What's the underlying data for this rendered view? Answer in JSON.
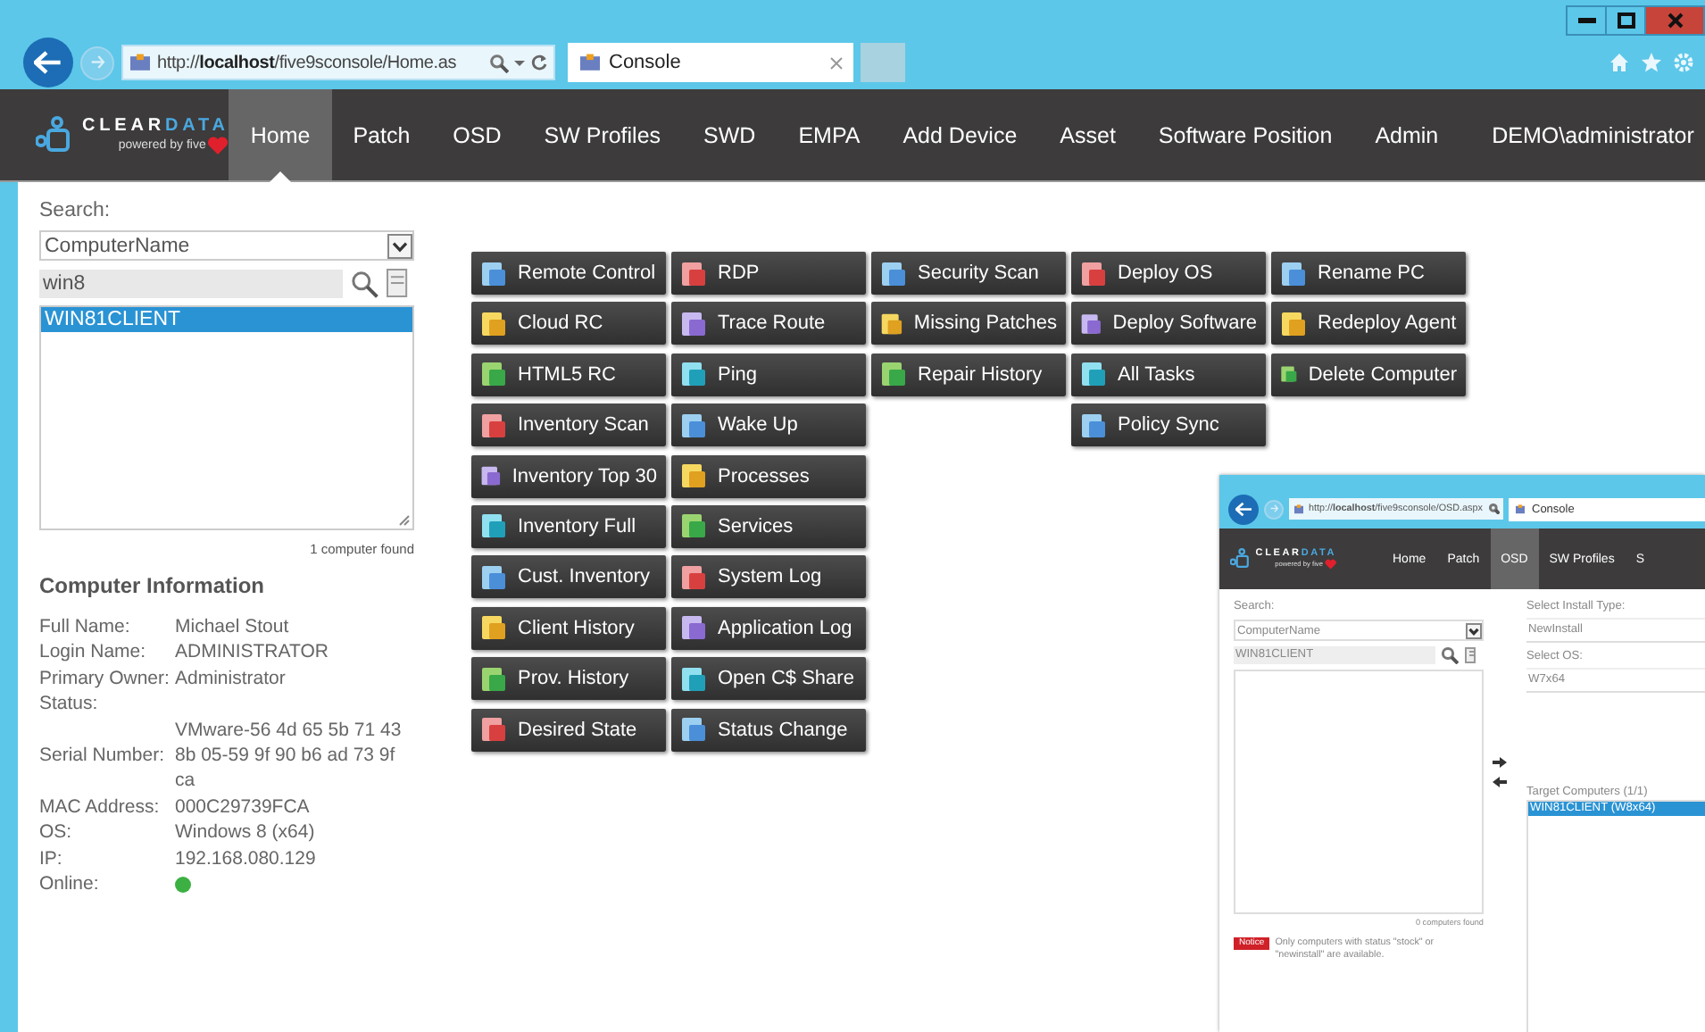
{
  "browser": {
    "address": "http://**localhost**/five9sconsole/Home.as",
    "tab_title": "Console"
  },
  "nav": {
    "logo": {
      "word_primary": "CLEAR",
      "word_accent": "DATA",
      "tagline": "powered by five"
    },
    "items": [
      {
        "label": "Home",
        "selected": true
      },
      {
        "label": "Patch",
        "selected": false
      },
      {
        "label": "OSD",
        "selected": false
      },
      {
        "label": "SW Profiles",
        "selected": false
      },
      {
        "label": "SWD",
        "selected": false
      },
      {
        "label": "EMPA",
        "selected": false
      },
      {
        "label": "Add Device",
        "selected": false
      },
      {
        "label": "Asset",
        "selected": false
      },
      {
        "label": "Software Position",
        "selected": false
      },
      {
        "label": "Admin",
        "selected": false
      },
      {
        "label": "DEMO\\administrator",
        "selected": false
      }
    ]
  },
  "search": {
    "label": "Search:",
    "field": "ComputerName",
    "query": "win8",
    "results": [
      {
        "name": "WIN81CLIENT",
        "selected": true
      }
    ],
    "count": "1 computer found"
  },
  "computer_info": {
    "title": "Computer Information",
    "rows": [
      {
        "kind": "text",
        "label": "Full Name:",
        "value": "Michael Stout"
      },
      {
        "kind": "text",
        "label": "Login Name:",
        "value": "ADMINISTRATOR"
      },
      {
        "kind": "text",
        "label": "Primary Owner:",
        "value": "Administrator"
      },
      {
        "kind": "text",
        "label": "Status:"
      },
      {
        "kind": "text",
        "label": "Serial Number:",
        "value": "VMware-56 4d 65 5b 71 43 8b 05-59 9f 90 b6 ad 73 9f ca"
      },
      {
        "kind": "text",
        "label": "MAC Address:",
        "value": "000C29739FCA"
      },
      {
        "kind": "text",
        "label": "OS:",
        "value": "Windows 8 (x64)"
      },
      {
        "kind": "text",
        "label": "IP:",
        "value": "192.168.080.129"
      },
      {
        "kind": "status",
        "label": "Online:",
        "online": true
      }
    ]
  },
  "actions": {
    "columns": [
      [
        {
          "label": "Remote Control"
        },
        {
          "label": "Cloud RC"
        },
        {
          "label": "HTML5 RC"
        },
        {
          "label": "Inventory Scan"
        },
        {
          "label": "Inventory Top 30"
        },
        {
          "label": "Inventory Full"
        },
        {
          "label": "Cust. Inventory"
        },
        {
          "label": "Client History"
        },
        {
          "label": "Prov. History"
        },
        {
          "label": "Desired State"
        }
      ],
      [
        {
          "label": "RDP"
        },
        {
          "label": "Trace Route"
        },
        {
          "label": "Ping"
        },
        {
          "label": "Wake Up"
        },
        {
          "label": "Processes"
        },
        {
          "label": "Services"
        },
        {
          "label": "System Log"
        },
        {
          "label": "Application Log"
        },
        {
          "label": "Open C$ Share"
        },
        {
          "label": "Status Change"
        }
      ],
      [
        {
          "label": "Security Scan"
        },
        {
          "label": "Missing Patches"
        },
        {
          "label": "Repair History"
        }
      ],
      [
        {
          "label": "Deploy OS"
        },
        {
          "label": "Deploy Software"
        },
        {
          "label": "All Tasks"
        },
        {
          "label": "Policy Sync"
        }
      ],
      [
        {
          "label": "Rename PC"
        },
        {
          "label": "Redeploy Agent"
        },
        {
          "label": "Delete Computer"
        }
      ]
    ]
  },
  "inset": {
    "address": "http://**localhost**/five9sconsole/OSD.aspx",
    "tab_title": "Console",
    "logo": {
      "word_primary": "CLEAR",
      "word_accent": "DATA",
      "tagline": "powered by five"
    },
    "nav": [
      {
        "label": "Home",
        "selected": false
      },
      {
        "label": "Patch",
        "selected": false
      },
      {
        "label": "OSD",
        "selected": true
      },
      {
        "label": "SW Profiles",
        "selected": false
      },
      {
        "label": "S",
        "selected": false
      }
    ],
    "search_label": "Search:",
    "field": "ComputerName",
    "query": "WIN81CLIENT",
    "count": "0 computers found",
    "notice_badge": "Notice",
    "notice": "Only computers with status \"stock\" or \"newinstall\" are available.",
    "install_type_label": "Select Install Type:",
    "install_type": "NewInstall",
    "os_label": "Select OS:",
    "os": "W7x64",
    "targets_label": "Target Computers (1/1)",
    "targets": [
      {
        "name": "WIN81CLIENT (W8x64)",
        "selected": true
      }
    ]
  }
}
